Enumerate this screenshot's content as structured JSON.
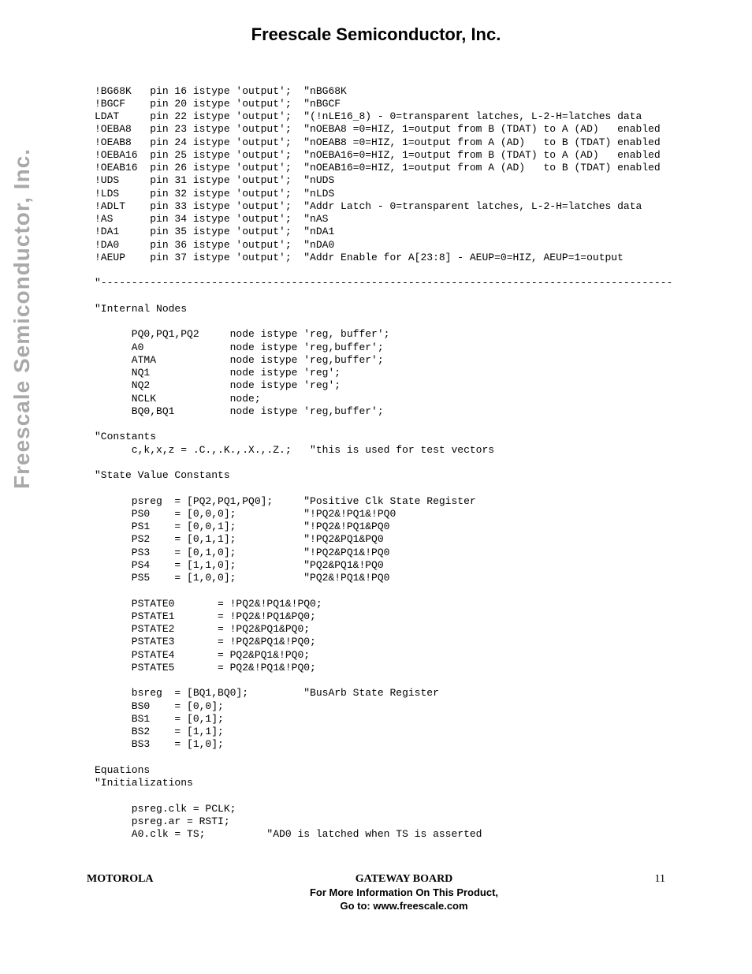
{
  "header": {
    "title": "Freescale Semiconductor, Inc."
  },
  "sidebar": {
    "text": "Freescale Semiconductor, Inc."
  },
  "code": "!BG68K   pin 16 istype 'output';  \"nBG68K\n!BGCF    pin 20 istype 'output';  \"nBGCF\nLDAT     pin 22 istype 'output';  \"(!nLE16_8) - 0=transparent latches, L-2-H=latches data\n!OEBA8   pin 23 istype 'output';  \"nOEBA8 =0=HIZ, 1=output from B (TDAT) to A (AD)   enabled\n!OEAB8   pin 24 istype 'output';  \"nOEAB8 =0=HIZ, 1=output from A (AD)   to B (TDAT) enabled\n!OEBA16  pin 25 istype 'output';  \"nOEBA16=0=HIZ, 1=output from B (TDAT) to A (AD)   enabled\n!OEAB16  pin 26 istype 'output';  \"nOEAB16=0=HIZ, 1=output from A (AD)   to B (TDAT) enabled\n!UDS     pin 31 istype 'output';  \"nUDS\n!LDS     pin 32 istype 'output';  \"nLDS\n!ADLT    pin 33 istype 'output';  \"Addr Latch - 0=transparent latches, L-2-H=latches data\n!AS      pin 34 istype 'output';  \"nAS\n!DA1     pin 35 istype 'output';  \"nDA1\n!DA0     pin 36 istype 'output';  \"nDA0\n!AEUP    pin 37 istype 'output';  \"Addr Enable for A[23:8] - AEUP=0=HIZ, AEUP=1=output\n\n\"---------------------------------------------------------------------------------------------\n\n\"Internal Nodes\n\n      PQ0,PQ1,PQ2     node istype 'reg, buffer';\n      A0              node istype 'reg,buffer';\n      ATMA            node istype 'reg,buffer';\n      NQ1             node istype 'reg';\n      NQ2             node istype 'reg';\n      NCLK            node;\n      BQ0,BQ1         node istype 'reg,buffer';\n\n\"Constants\n      c,k,x,z = .C.,.K.,.X.,.Z.;   \"this is used for test vectors\n\n\"State Value Constants\n\n      psreg  = [PQ2,PQ1,PQ0];     \"Positive Clk State Register\n      PS0    = [0,0,0];           \"!PQ2&!PQ1&!PQ0\n      PS1    = [0,0,1];           \"!PQ2&!PQ1&PQ0\n      PS2    = [0,1,1];           \"!PQ2&PQ1&PQ0\n      PS3    = [0,1,0];           \"!PQ2&PQ1&!PQ0\n      PS4    = [1,1,0];           \"PQ2&PQ1&!PQ0\n      PS5    = [1,0,0];           \"PQ2&!PQ1&!PQ0\n\n      PSTATE0       = !PQ2&!PQ1&!PQ0;\n      PSTATE1       = !PQ2&!PQ1&PQ0;\n      PSTATE2       = !PQ2&PQ1&PQ0;\n      PSTATE3       = !PQ2&PQ1&!PQ0;\n      PSTATE4       = PQ2&PQ1&!PQ0;\n      PSTATE5       = PQ2&!PQ1&!PQ0;\n\n      bsreg  = [BQ1,BQ0];         \"BusArb State Register\n      BS0    = [0,0];\n      BS1    = [0,1];\n      BS2    = [1,1];\n      BS3    = [1,0];\n\nEquations\n\"Initializations\n\n      psreg.clk = PCLK;\n      psreg.ar = RSTI;\n      A0.clk = TS;          \"AD0 is latched when TS is asserted",
  "footer": {
    "left": "MOTOROLA",
    "center1": "GATEWAY BOARD",
    "center2": "For More Information On This Product,",
    "center3": "Go to: www.freescale.com",
    "right": "11"
  }
}
